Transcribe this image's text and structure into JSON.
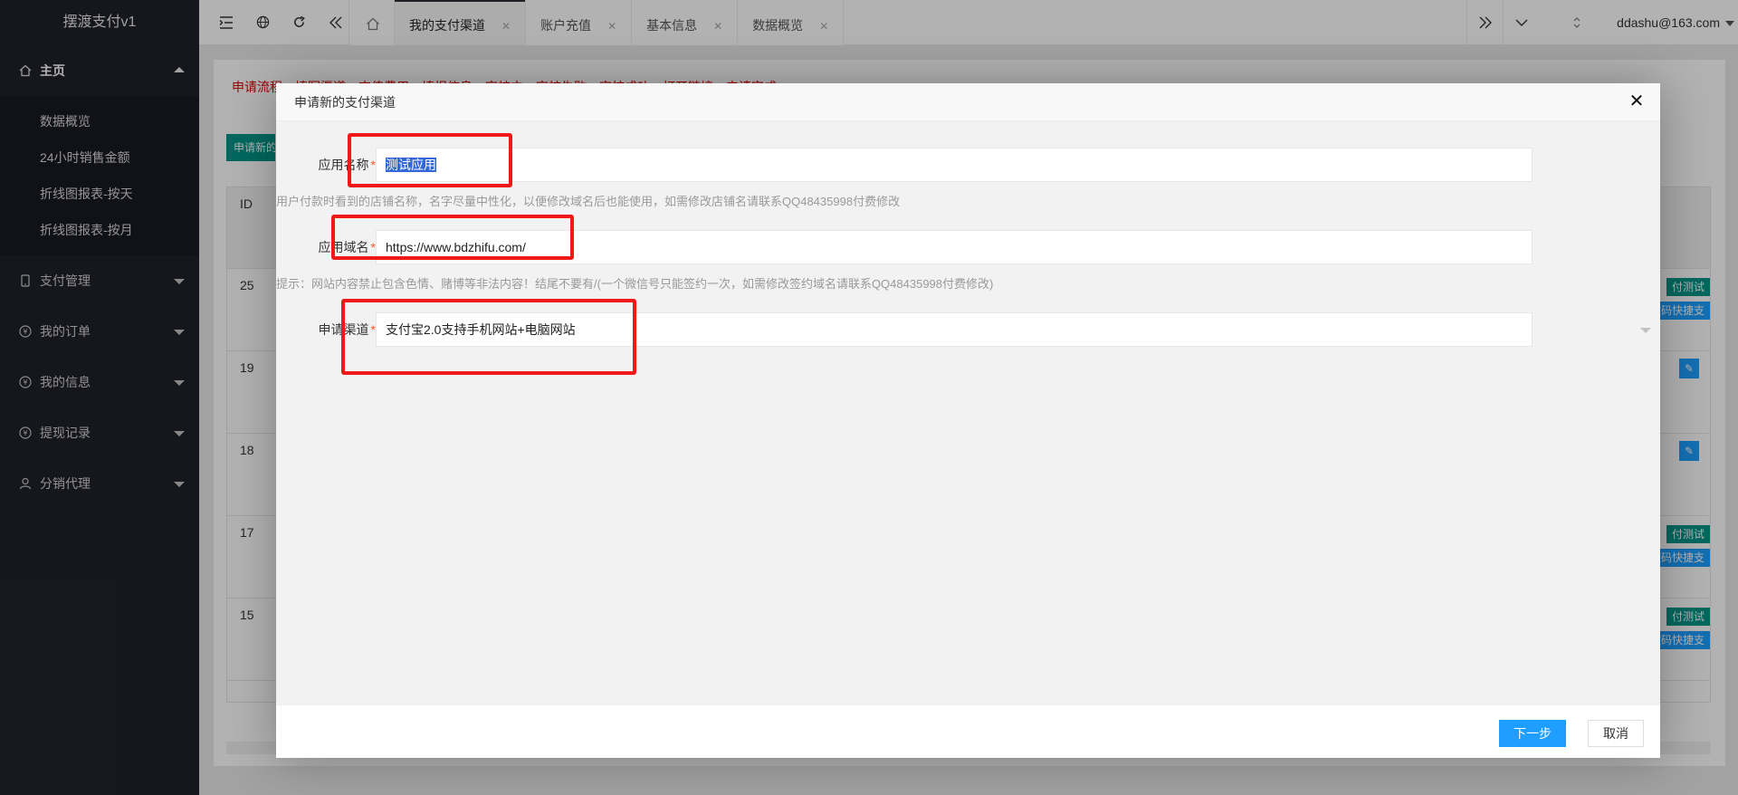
{
  "app": {
    "title": "摆渡支付v1"
  },
  "sidebar": {
    "home": {
      "label": "主页",
      "icon": "home-icon"
    },
    "home_sub": [
      "数据概览",
      "24小时销售金额",
      "折线图报表-按天",
      "折线图报表-按月"
    ],
    "items": [
      {
        "label": "支付管理",
        "icon": "phone-icon"
      },
      {
        "label": "我的订单",
        "icon": "yen-icon"
      },
      {
        "label": "我的信息",
        "icon": "yen-icon"
      },
      {
        "label": "提现记录",
        "icon": "yen-icon"
      },
      {
        "label": "分销代理",
        "icon": "user-icon"
      }
    ]
  },
  "topbar": {
    "tabs": [
      {
        "label": "我的支付渠道",
        "active": true
      },
      {
        "label": "账户充值"
      },
      {
        "label": "基本信息"
      },
      {
        "label": "数据概览"
      }
    ],
    "user": "ddashu@163.com"
  },
  "background": {
    "steps": "申请流程：填写渠道→充值费用→填报信息→审核中→审核失败→审核成功→打开链接→申请完成",
    "apply_button": "申请新的",
    "table_header_id": "ID",
    "rows": [
      {
        "id": "25",
        "tag_test": "付测试",
        "tag_quick": "款码快捷支"
      },
      {
        "id": "19"
      },
      {
        "id": "18"
      },
      {
        "id": "17",
        "tag_test": "付测试",
        "tag_quick": "款码快捷支"
      },
      {
        "id": "15",
        "tag_test": "付测试",
        "tag_quick": "款码快捷支"
      }
    ]
  },
  "modal": {
    "title": "申请新的支付渠道",
    "fields": {
      "app_name": {
        "label": "应用名称",
        "value": "测试应用",
        "hint": "用户付款时看到的店铺名称，名字尽量中性化，以便修改域名后也能使用，如需修改店铺名请联系QQ48435998付费修改"
      },
      "app_domain": {
        "label": "应用域名",
        "value": "https://www.bdzhifu.com/",
        "hint": "提示：网站内容禁止包含色情、赌博等非法内容！结尾不要有/(一个微信号只能签约一次，如需修改签约域名请联系QQ48435998付费修改)"
      },
      "channel": {
        "label": "申请渠道",
        "value": "支付宝2.0支持手机网站+电脑网站"
      }
    },
    "buttons": {
      "next": "下一步",
      "cancel": "取消"
    }
  },
  "colors": {
    "sidebar": "#20222a",
    "primary": "#1e9fff",
    "green": "#009688",
    "highlight": "#f01818"
  }
}
